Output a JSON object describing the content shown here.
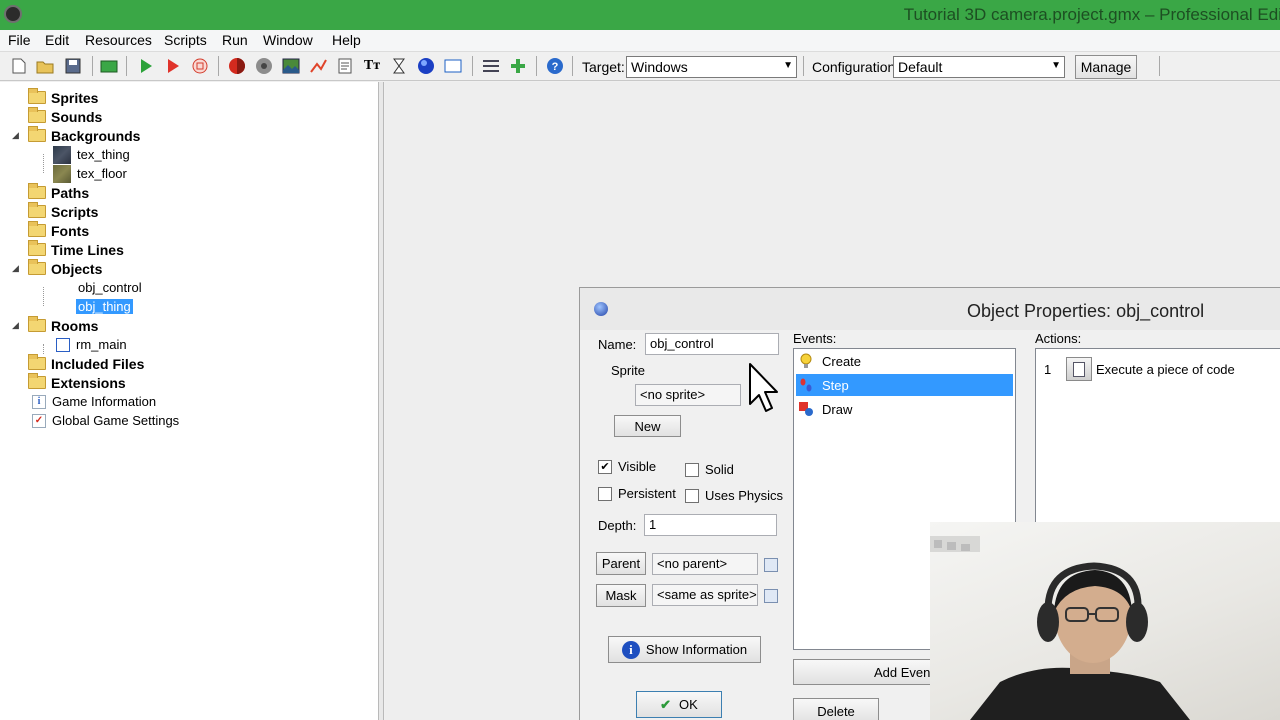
{
  "window": {
    "title": "Tutorial 3D camera.project.gmx  –  Professional Edi"
  },
  "menu": [
    "File",
    "Edit",
    "Resources",
    "Scripts",
    "Run",
    "Window",
    "Help"
  ],
  "toolbar": {
    "target_label": "Target:",
    "target_value": "Windows",
    "config_label": "Configuration:",
    "config_value": "Default",
    "manage_label": "Manage"
  },
  "tree": {
    "sprites": "Sprites",
    "sounds": "Sounds",
    "backgrounds": "Backgrounds",
    "bg_items": [
      "tex_thing",
      "tex_floor"
    ],
    "paths": "Paths",
    "scripts": "Scripts",
    "fonts": "Fonts",
    "timelines": "Time Lines",
    "objects": "Objects",
    "obj_items": [
      "obj_control",
      "obj_thing"
    ],
    "rooms": "Rooms",
    "room_items": [
      "rm_main"
    ],
    "included": "Included Files",
    "extensions": "Extensions",
    "game_info": "Game Information",
    "global_settings": "Global Game Settings"
  },
  "dialog": {
    "title": "Object Properties: obj_control",
    "name_label": "Name:",
    "name_value": "obj_control",
    "sprite_group": "Sprite",
    "sprite_value": "<no sprite>",
    "new_button": "New",
    "visible_label": "Visible",
    "solid_label": "Solid",
    "persistent_label": "Persistent",
    "physics_label": "Uses Physics",
    "depth_label": "Depth:",
    "depth_value": "1",
    "parent_button": "Parent",
    "parent_value": "<no parent>",
    "mask_button": "Mask",
    "mask_value": "<same as sprite>",
    "show_info_button": "Show Information",
    "ok_button": "OK",
    "events_label": "Events:",
    "events": [
      "Create",
      "Step",
      "Draw"
    ],
    "add_event_button": "Add Even",
    "delete_button": "Delete",
    "actions_label": "Actions:",
    "actions": [
      {
        "num": "1",
        "text": "Execute a piece of code"
      }
    ]
  },
  "checkbox_states": {
    "visible": true,
    "solid": false,
    "persistent": false,
    "physics": false
  }
}
